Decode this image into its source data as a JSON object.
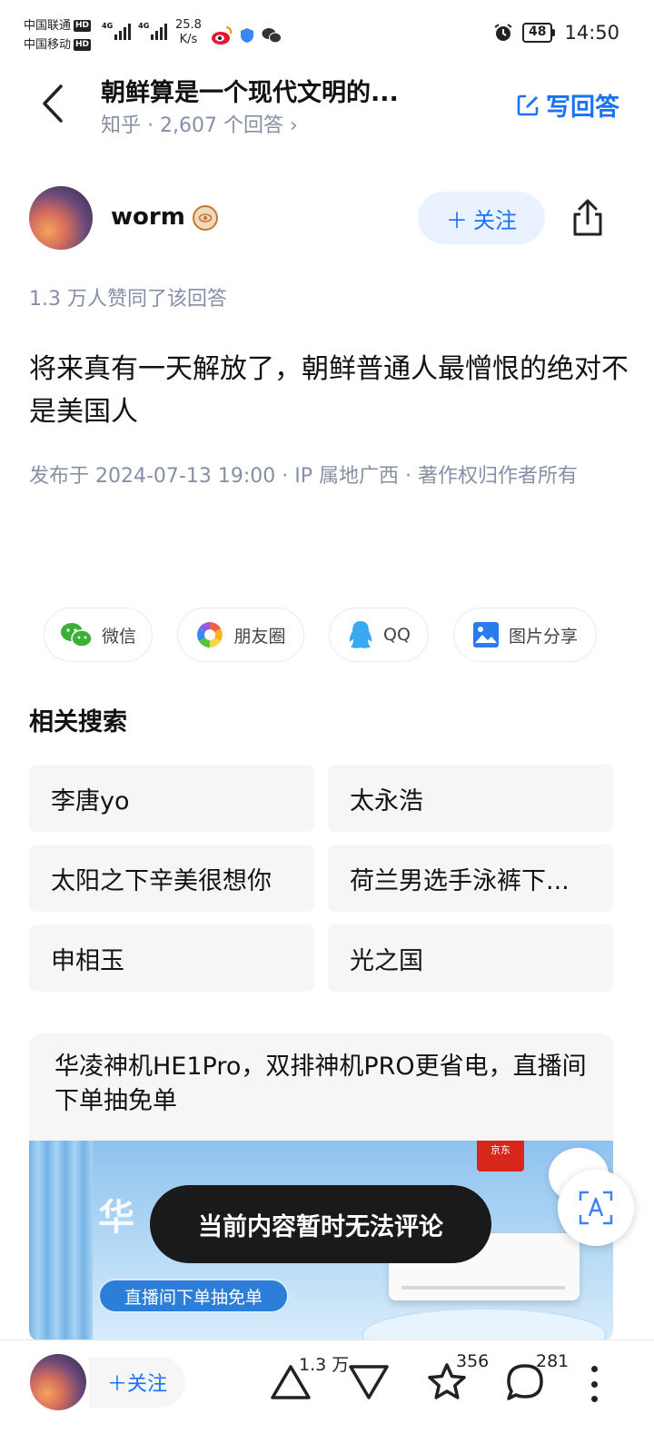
{
  "status_bar": {
    "carrier1": "中国联通",
    "carrier2": "中国移动",
    "hd_label": "HD",
    "network_label": "4G",
    "speed_value": "25.8",
    "speed_unit": "K/s",
    "battery": "48",
    "time": "14:50"
  },
  "header": {
    "title": "朝鲜算是一个现代文明的...",
    "subtitle": "知乎 · 2,607 个回答 ›",
    "write_answer": "写回答"
  },
  "author": {
    "name": "worm",
    "follow_label": "关注"
  },
  "answer": {
    "agree_text": "1.3 万人赞同了该回答",
    "content": "将来真有一天解放了，朝鲜普通人最憎恨的绝对不是美国人",
    "meta": "发布于 2024-07-13 19:00 · IP 属地广西 · 著作权归作者所有"
  },
  "share": {
    "wechat": "微信",
    "moments": "朋友圈",
    "qq": "QQ",
    "image_share": "图片分享"
  },
  "related": {
    "title": "相关搜索",
    "items": [
      "李唐yo",
      "太永浩",
      "太阳之下辛美很想你",
      "荷兰男选手泳裤下...",
      "申相玉",
      "光之国"
    ]
  },
  "ad": {
    "text": "华凌神机HE1Pro，双排神机PRO更省电，直播间下单抽免单",
    "jd_label": "京东",
    "brand_partial": "华    HE1Pro",
    "banner": "直播间下单抽免单"
  },
  "toast": {
    "text": "当前内容暂时无法评论"
  },
  "bottom_bar": {
    "follow_label": "关注",
    "upvote_count": "1.3 万",
    "favorite_count": "356",
    "comment_count": "281"
  },
  "colors": {
    "accent": "#1772f6",
    "muted": "#8590a6",
    "text": "#121212"
  }
}
